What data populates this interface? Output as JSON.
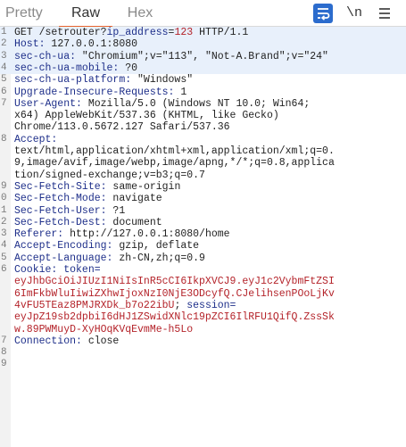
{
  "tabs": {
    "pretty": "Pretty",
    "raw": "Raw",
    "hex": "Hex"
  },
  "toolbar": {
    "wrap_icon": "wrap-lines-icon",
    "newline_label": "\\n",
    "menu_icon": "hamburger-menu-icon"
  },
  "colors": {
    "accent_tab": "#e8642e",
    "wrap_button": "#2c6ccd",
    "header_name": "#1e2f8a",
    "param_value": "#b4232a"
  },
  "request": {
    "l1": {
      "num": "1",
      "method": "GET /setrouter?",
      "param_name": "ip_address",
      "eq": "=",
      "param_value": "123",
      "proto": " HTTP/1.1"
    },
    "l2": {
      "num": "2",
      "key": "Host:",
      "val": " 127.0.0.1:8080"
    },
    "l3": {
      "num": "3",
      "key": "sec-ch-ua:",
      "val": " \"Chromium\";v=\"113\", \"Not-A.Brand\";v=\"24\""
    },
    "l4": {
      "num": "4",
      "key": "sec-ch-ua-mobile:",
      "val": " ?0"
    },
    "l5": {
      "num": "5",
      "key": "sec-ch-ua-platform:",
      "val": " \"Windows\""
    },
    "l6": {
      "num": "6",
      "key": "Upgrade-Insecure-Requests:",
      "val": " 1"
    },
    "l7": {
      "num": "7",
      "key": "User-Agent:",
      "val": " Mozilla/5.0 (Windows NT 10.0; Win64;",
      "cont1": "x64) AppleWebKit/537.36 (KHTML, like Gecko)",
      "cont2": "Chrome/113.0.5672.127 Safari/537.36"
    },
    "l8": {
      "num": "8",
      "key": "Accept:",
      "cont1": "text/html,application/xhtml+xml,application/xml;q=0.",
      "cont2": "9,image/avif,image/webp,image/apng,*/*;q=0.8,applica",
      "cont3": "tion/signed-exchange;v=b3;q=0.7"
    },
    "l9": {
      "num": "9",
      "key": "Sec-Fetch-Site:",
      "val": " same-origin"
    },
    "l10": {
      "num": "0",
      "key": "Sec-Fetch-Mode:",
      "val": " navigate"
    },
    "l11": {
      "num": "1",
      "key": "Sec-Fetch-User:",
      "val": " ?1"
    },
    "l12": {
      "num": "2",
      "key": "Sec-Fetch-Dest:",
      "val": " document"
    },
    "l13": {
      "num": "3",
      "key": "Referer:",
      "val": " http://127.0.0.1:8080/home"
    },
    "l14": {
      "num": "4",
      "key": "Accept-Encoding:",
      "val": " gzip, deflate"
    },
    "l15": {
      "num": "5",
      "key": "Accept-Language:",
      "val": " zh-CN,zh;q=0.9"
    },
    "l16": {
      "num": "6",
      "key": "Cookie:",
      "token_name": " token=",
      "token1": "eyJhbGciOiJIUzI1NiIsInR5cCI6IkpXVCJ9.eyJ1c2VybmFtZSI",
      "token2": "6ImFkbWluIiwiZXhwIjoxNzI0NjE3ODcyfQ.CJelihsenPOoLjKv",
      "token3": "4vFU5TEaz8PMJRXDk_b7o22ibU",
      "sep": "; ",
      "session_name": "session=",
      "session1": "eyJpZ19sb2dpbiI6dHJ1ZSwidXNlc19pZCI6IlRFU1QifQ.ZssSk",
      "session2": "w.89PWMuyD-XyHOqKVqEvmMe-h5Lo"
    },
    "l17": {
      "num": "7",
      "key": "Connection:",
      "val": " close"
    },
    "l18": {
      "num": "8"
    },
    "l19": {
      "num": "9"
    }
  }
}
